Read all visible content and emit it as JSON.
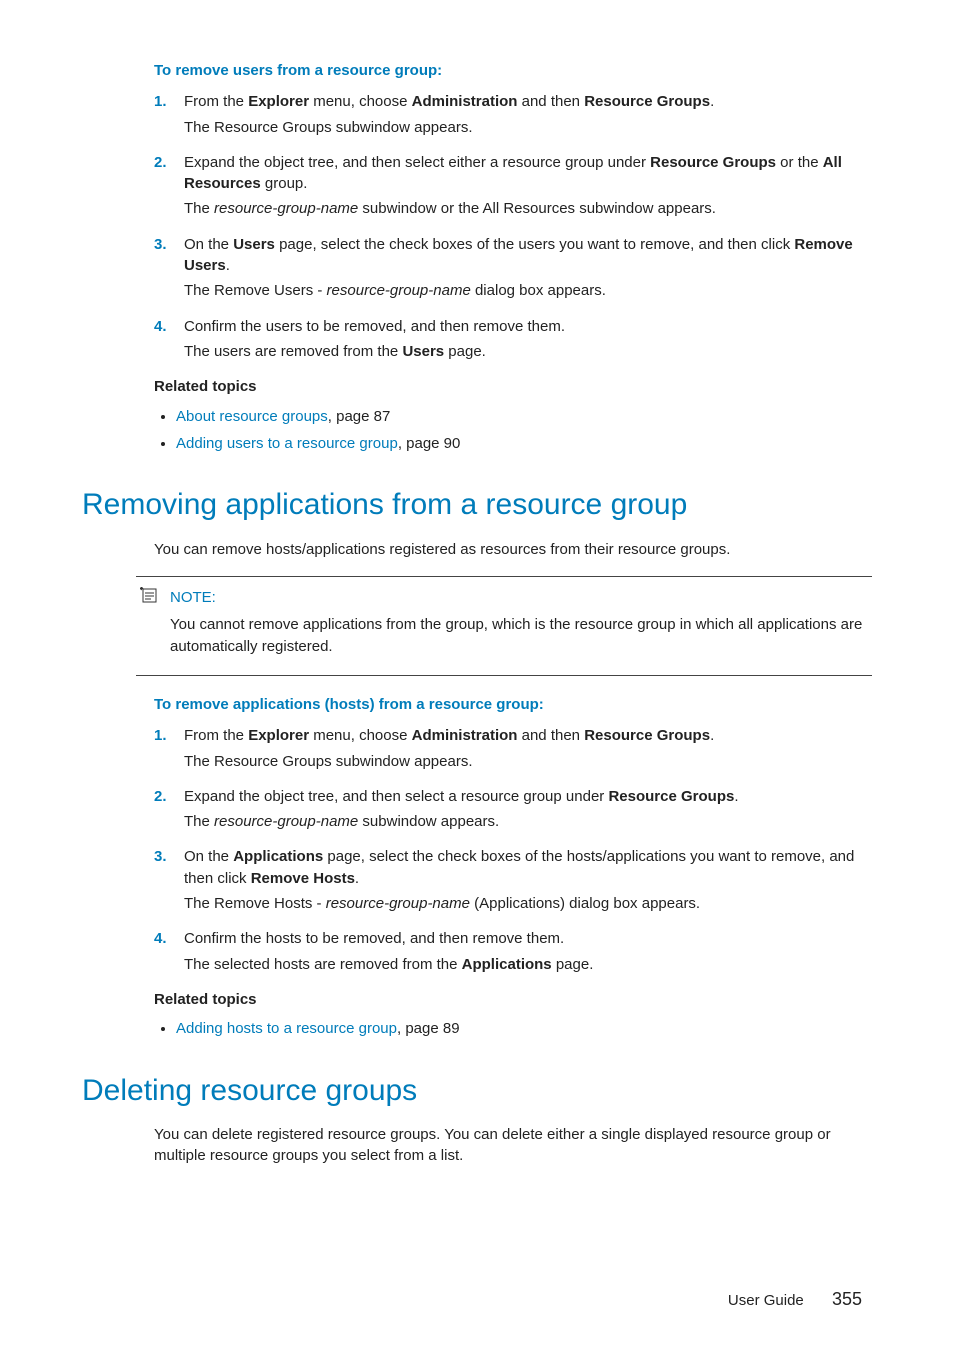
{
  "sec1": {
    "intro": "To remove users from a resource group:",
    "s1a": "From the ",
    "s1b": "Explorer",
    "s1c": " menu, choose ",
    "s1d": "Administration",
    "s1e": " and then ",
    "s1f": "Resource Groups",
    "s1g": ".",
    "s1r": "The Resource Groups subwindow appears.",
    "s2a": "Expand the object tree, and then select either a resource group under ",
    "s2b": "Resource Groups",
    "s2c": " or the ",
    "s2d": "All Resources",
    "s2e": " group.",
    "s2r1": "The ",
    "s2r2": "resource-group-name",
    "s2r3": " subwindow or the All Resources subwindow appears.",
    "s3a": "On the ",
    "s3b": "Users",
    "s3c": " page, select the check boxes of the users you want to remove, and then click ",
    "s3d": "Remove Users",
    "s3e": ".",
    "s3r1": "The Remove Users - ",
    "s3r2": "resource-group-name",
    "s3r3": " dialog box appears.",
    "s4a": "Confirm the users to be removed, and then remove them.",
    "s4r1": "The users are removed from the ",
    "s4r2": "Users",
    "s4r3": " page.",
    "relatedH": "Related topics",
    "rel1a": "About resource groups",
    "rel1b": ", page 87",
    "rel2a": "Adding users to a resource group",
    "rel2b": ", page 90"
  },
  "sec2": {
    "h": "Removing applications from a resource group",
    "intro": "You can remove hosts/applications registered as resources from their resource groups.",
    "noteH": "NOTE:",
    "noteBody": "You cannot remove applications from the                                         group, which is the resource group in which all applications are automatically registered.",
    "procH": "To remove applications (hosts) from a resource group:",
    "s1a": "From the ",
    "s1b": "Explorer",
    "s1c": " menu, choose ",
    "s1d": "Administration",
    "s1e": " and then ",
    "s1f": "Resource Groups",
    "s1g": ".",
    "s1r": "The Resource Groups subwindow appears.",
    "s2a": "Expand the object tree, and then select a resource group under ",
    "s2b": "Resource Groups",
    "s2c": ".",
    "s2r1": "The ",
    "s2r2": "resource-group-name",
    "s2r3": " subwindow appears.",
    "s3a": "On the ",
    "s3b": "Applications",
    "s3c": " page, select the check boxes of the hosts/applications you want to remove, and then click ",
    "s3d": "Remove Hosts",
    "s3e": ".",
    "s3r1": "The Remove Hosts - ",
    "s3r2": "resource-group-name",
    "s3r3": " (Applications) dialog box appears.",
    "s4a": "Confirm the hosts to be removed, and then remove them.",
    "s4r1": "The selected hosts are removed from the ",
    "s4r2": "Applications",
    "s4r3": " page.",
    "relatedH": "Related topics",
    "rel1a": "Adding hosts to a resource group",
    "rel1b": ", page 89"
  },
  "sec3": {
    "h": "Deleting resource groups",
    "intro": "You can delete registered resource groups. You can delete either a single displayed resource group or multiple resource groups you select from a list."
  },
  "footer": {
    "label": "User Guide",
    "page": "355"
  },
  "nums": {
    "1": "1.",
    "2": "2.",
    "3": "3.",
    "4": "4."
  }
}
